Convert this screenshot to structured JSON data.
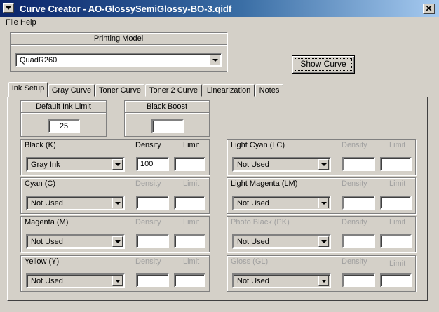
{
  "window": {
    "title": "Curve Creator - AO-GlossySemiGlossy-BO-3.qidf"
  },
  "menu": {
    "file": "File",
    "help": "Help"
  },
  "printing_model": {
    "heading": "Printing Model",
    "value": "QuadR260"
  },
  "show_curve_label": "Show Curve",
  "tabs": [
    "Ink Setup",
    "Gray Curve",
    "Toner Curve",
    "Toner 2 Curve",
    "Linearization",
    "Notes"
  ],
  "ink_limit": {
    "heading": "Default Ink Limit",
    "value": "25"
  },
  "black_boost": {
    "heading": "Black Boost",
    "value": ""
  },
  "column_labels": {
    "density": "Density",
    "limit": "Limit"
  },
  "inks": [
    {
      "name": "Black (K)",
      "type": "Gray Ink",
      "density": "100",
      "limit": "",
      "enabled": true
    },
    {
      "name": "Cyan (C)",
      "type": "Not Used",
      "density": "",
      "limit": "",
      "enabled": true
    },
    {
      "name": "Magenta (M)",
      "type": "Not Used",
      "density": "",
      "limit": "",
      "enabled": true
    },
    {
      "name": "Yellow (Y)",
      "type": "Not Used",
      "density": "",
      "limit": "",
      "enabled": true
    },
    {
      "name": "Light Cyan (LC)",
      "type": "Not Used",
      "density": "",
      "limit": "",
      "enabled": true
    },
    {
      "name": "Light Magenta (LM)",
      "type": "Not Used",
      "density": "",
      "limit": "",
      "enabled": true
    },
    {
      "name": "Photo Black (PK)",
      "type": "Not Used",
      "density": "",
      "limit": "",
      "enabled": false
    },
    {
      "name": "Gloss (GL)",
      "type": "Not Used",
      "density": "",
      "limit": "",
      "enabled": false
    }
  ],
  "colors": {
    "title_start": "#0a246a",
    "title_end": "#a6caf0",
    "face": "#d4d0c8",
    "disabled_text": "#a0a0a0"
  }
}
